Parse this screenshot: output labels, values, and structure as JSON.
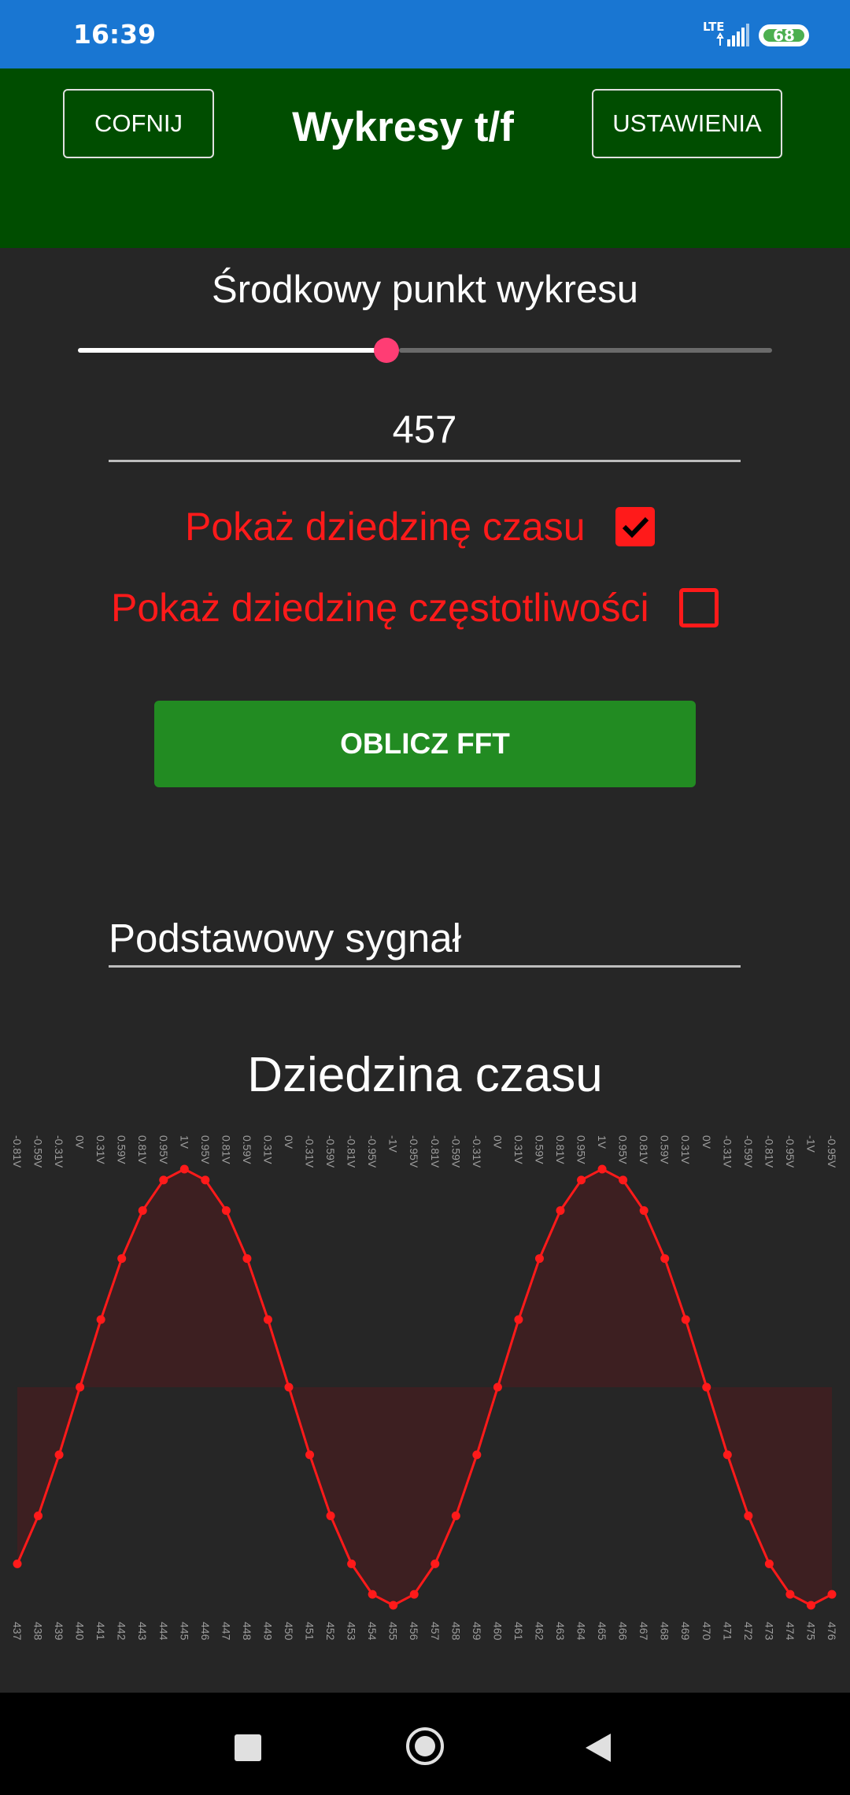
{
  "status_bar": {
    "time": "16:39",
    "network": "LTE",
    "battery": "68",
    "battery_color": "#4caf50"
  },
  "header": {
    "back_label": "COFNIJ",
    "title": "Wykresy t/f",
    "settings_label": "USTAWIENIA"
  },
  "slider": {
    "label": "Środkowy punkt wykresu",
    "value_fraction": 0.445
  },
  "center_input": {
    "value": "457"
  },
  "options": {
    "time_domain": {
      "label": "Pokaż dziedzinę czasu",
      "checked": true
    },
    "freq_domain": {
      "label": "Pokaż dziedzinę częstotliwości",
      "checked": false
    }
  },
  "fft_button": {
    "label": "OBLICZ FFT"
  },
  "signal_field": {
    "value": "Podstawowy sygnał"
  },
  "chart_data": {
    "type": "area",
    "title": "Dziedzina czasu",
    "x": [
      437,
      438,
      439,
      440,
      441,
      442,
      443,
      444,
      445,
      446,
      447,
      448,
      449,
      450,
      451,
      452,
      453,
      454,
      455,
      456,
      457,
      458,
      459,
      460,
      461,
      462,
      463,
      464,
      465,
      466,
      467,
      468,
      469,
      470,
      471,
      472,
      473,
      474,
      475,
      476
    ],
    "values": [
      -0.81,
      -0.59,
      -0.31,
      0,
      0.31,
      0.59,
      0.81,
      0.95,
      1,
      0.95,
      0.81,
      0.59,
      0.31,
      0,
      -0.31,
      -0.59,
      -0.81,
      -0.95,
      -1,
      -0.95,
      -0.81,
      -0.59,
      -0.31,
      0,
      0.31,
      0.59,
      0.81,
      0.95,
      1,
      0.95,
      0.81,
      0.59,
      0.31,
      0,
      -0.31,
      -0.59,
      -0.81,
      -0.95,
      -1,
      -0.95
    ],
    "value_labels": [
      "-0.81V",
      "-0.59V",
      "-0.31V",
      "0V",
      "0.31V",
      "0.59V",
      "0.81V",
      "0.95V",
      "1V",
      "0.95V",
      "0.81V",
      "0.59V",
      "0.31V",
      "0V",
      "-0.31V",
      "-0.59V",
      "-0.81V",
      "-0.95V",
      "-1V",
      "-0.95V",
      "-0.81V",
      "-0.59V",
      "-0.31V",
      "0V",
      "0.31V",
      "0.59V",
      "0.81V",
      "0.95V",
      "1V",
      "0.95V",
      "0.81V",
      "0.59V",
      "0.31V",
      "0V",
      "-0.31V",
      "-0.59V",
      "-0.81V",
      "-0.95V",
      "-1V",
      "-0.95V"
    ],
    "ylim": [
      -1,
      1
    ],
    "line_color": "#ff1a1a",
    "fill_color": "#3d1f21",
    "label_color": "#9e9e9e"
  },
  "nav_bar": {
    "recent_icon": "square-icon",
    "home_icon": "circle-icon",
    "back_icon": "triangle-back-icon"
  }
}
